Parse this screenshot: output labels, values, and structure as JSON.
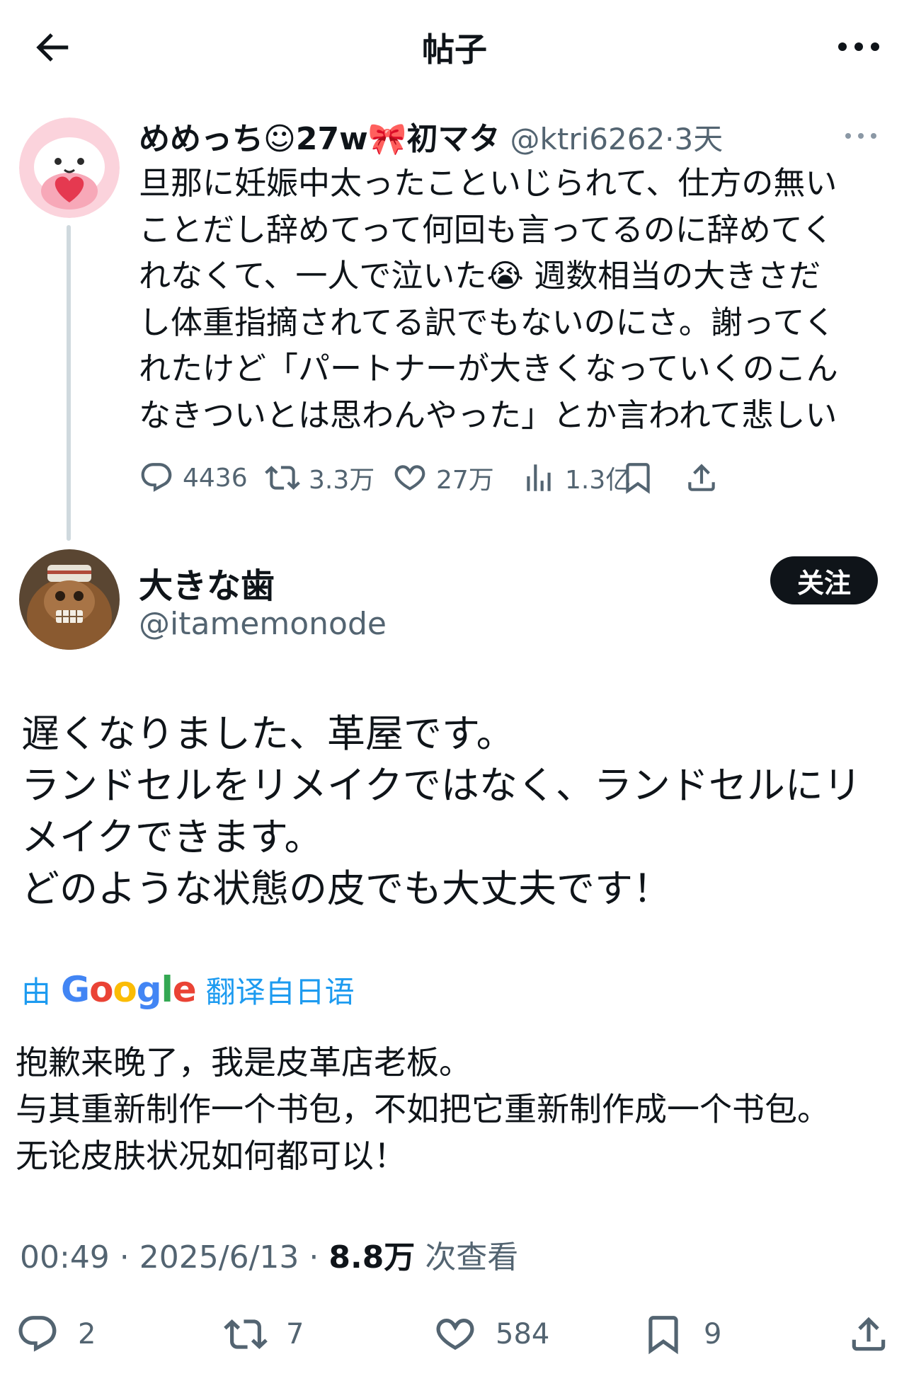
{
  "header": {
    "title": "帖子"
  },
  "parent_post": {
    "author_name": "めめっち☺27w🎀初マタ",
    "handle": "@ktri6262",
    "time": "3天",
    "text_lines": [
      "旦那に妊娠中太ったこといじられて、仕方の無い",
      "ことだし辞めてって何回も言ってるのに辞めてく",
      "れなくて、一人で泣いた😭 週数相当の大きさだ",
      "し体重指摘されてる訳でもないのにさ。謝ってく",
      "れたけど「パートナーが大きくなっていくのこん",
      "なきついとは思わんやった」とか言われて悲しい"
    ],
    "stats": {
      "replies": "4436",
      "reposts": "3.3万",
      "likes": "27万",
      "views": "1.3亿"
    }
  },
  "main_post": {
    "author_name": "大きな歯",
    "handle": "@itamemonode",
    "follow_label": "关注",
    "text_lines": [
      "遅くなりました、革屋です。",
      "ランドセルをリメイクではなく、ランドセルにリ",
      "メイクできます。",
      "どのような状態の皮でも大丈夫です！"
    ],
    "translation": {
      "prefix": "由",
      "provider": "Google",
      "suffix": "翻译自日语",
      "text_lines": [
        "抱歉来晚了，我是皮革店老板。",
        "与其重新制作一个书包，不如把它重新制作成一个书包。",
        "无论皮肤状况如何都可以！"
      ]
    },
    "timestamp": {
      "time": "00:49",
      "date": "2025/6/13",
      "views": "8.8万",
      "views_label": "次查看"
    },
    "stats": {
      "replies": "2",
      "reposts": "7",
      "likes": "584",
      "bookmarks": "9"
    }
  },
  "colors": {
    "text": "#0f1419",
    "secondary": "#536471",
    "link": "#1d9bf0",
    "line": "#cfd9de"
  }
}
